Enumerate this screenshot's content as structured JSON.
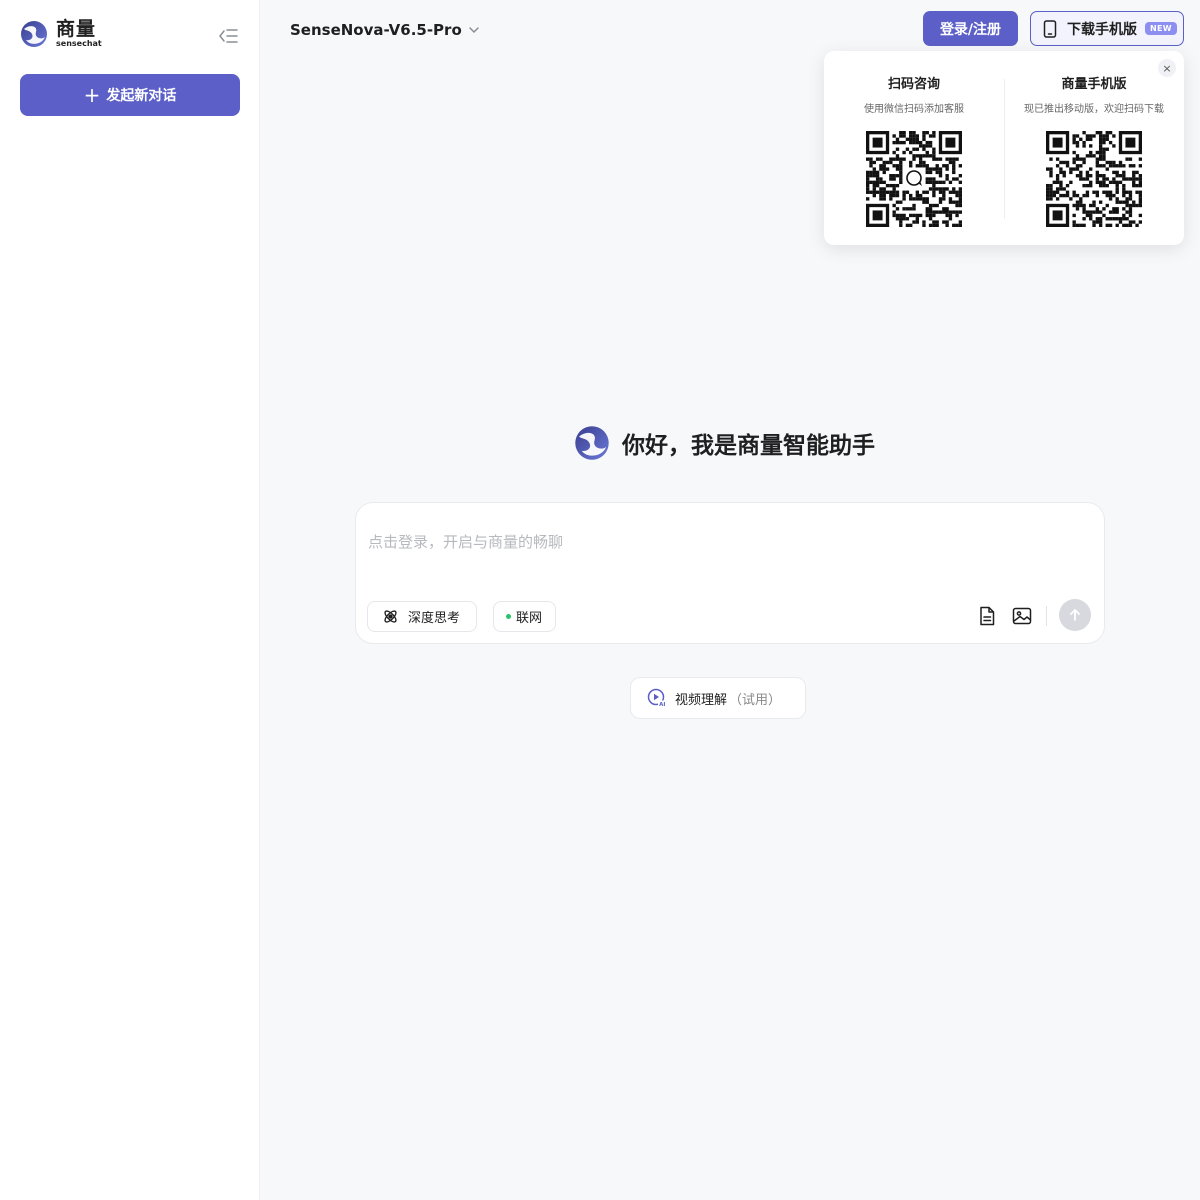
{
  "app": {
    "logo_cn": "商量",
    "logo_en": "sensechat"
  },
  "sidebar": {
    "new_chat_label": "发起新对话",
    "collapse_icon": "collapse-sidebar-icon"
  },
  "header": {
    "model_name": "SenseNova-V6.5-Pro",
    "login_label": "登录/注册",
    "download_label": "下载手机版",
    "new_badge": "NEW"
  },
  "qr_popover": {
    "left": {
      "title": "扫码咨询",
      "subtitle": "使用微信扫码添加客服"
    },
    "right": {
      "title": "商量手机版",
      "subtitle": "现已推出移动版，欢迎扫码下载"
    },
    "close_glyph": "×"
  },
  "main": {
    "greeting": "你好，我是商量智能助手",
    "input_placeholder": "点击登录，开启与商量的畅聊",
    "deep_think_label": "深度思考",
    "web_label": "联网",
    "video_label": "视频理解",
    "video_trial": "（试用）"
  },
  "colors": {
    "accent": "#5b5fc7",
    "badge": "#8d8ff0",
    "online_dot": "#27c46b"
  }
}
